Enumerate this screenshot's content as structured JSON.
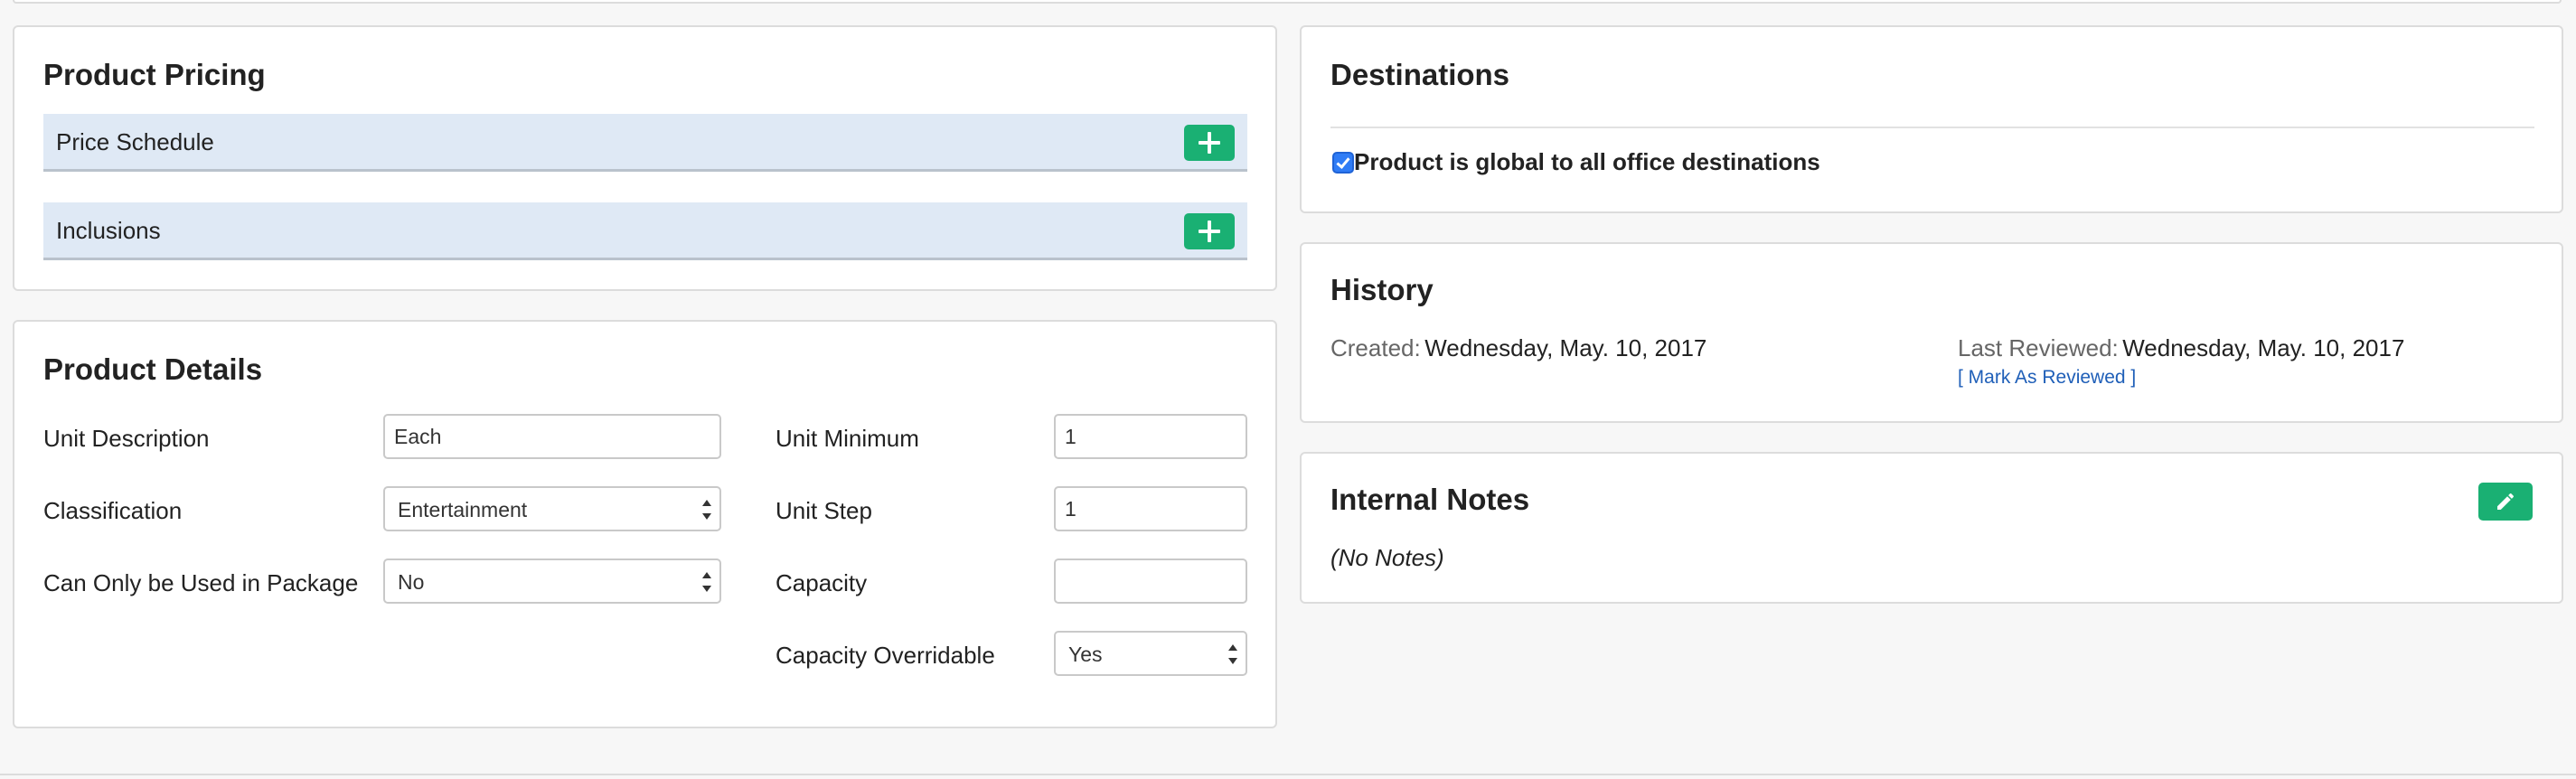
{
  "pricing": {
    "title": "Product Pricing",
    "rows": [
      {
        "label": "Price Schedule"
      },
      {
        "label": "Inclusions"
      }
    ]
  },
  "details": {
    "title": "Product Details",
    "unit_description": {
      "label": "Unit Description",
      "value": "Each"
    },
    "classification": {
      "label": "Classification",
      "value": "Entertainment"
    },
    "package_only": {
      "label": "Can Only be Used in Package",
      "value": "No"
    },
    "unit_minimum": {
      "label": "Unit Minimum",
      "value": "1"
    },
    "unit_step": {
      "label": "Unit Step",
      "value": "1"
    },
    "capacity": {
      "label": "Capacity",
      "value": ""
    },
    "capacity_overridable": {
      "label": "Capacity Overridable",
      "value": "Yes"
    }
  },
  "destinations": {
    "title": "Destinations",
    "global_label": "Product is global to all office destinations",
    "global_checked": true
  },
  "history": {
    "title": "History",
    "created_label": "Created:",
    "created_value": "Wednesday, May. 10, 2017",
    "reviewed_label": "Last Reviewed:",
    "reviewed_value": "Wednesday, May. 10, 2017",
    "mark_reviewed_link": "[ Mark As Reviewed ]"
  },
  "notes": {
    "title": "Internal Notes",
    "content": "(No Notes)"
  },
  "colors": {
    "accent_green": "#1ab073",
    "row_bg": "#dfe9f5",
    "link_blue": "#1f5fb8"
  },
  "icons": {
    "add": "plus-icon",
    "edit": "pencil-icon",
    "check": "checkbox-checked-icon"
  }
}
